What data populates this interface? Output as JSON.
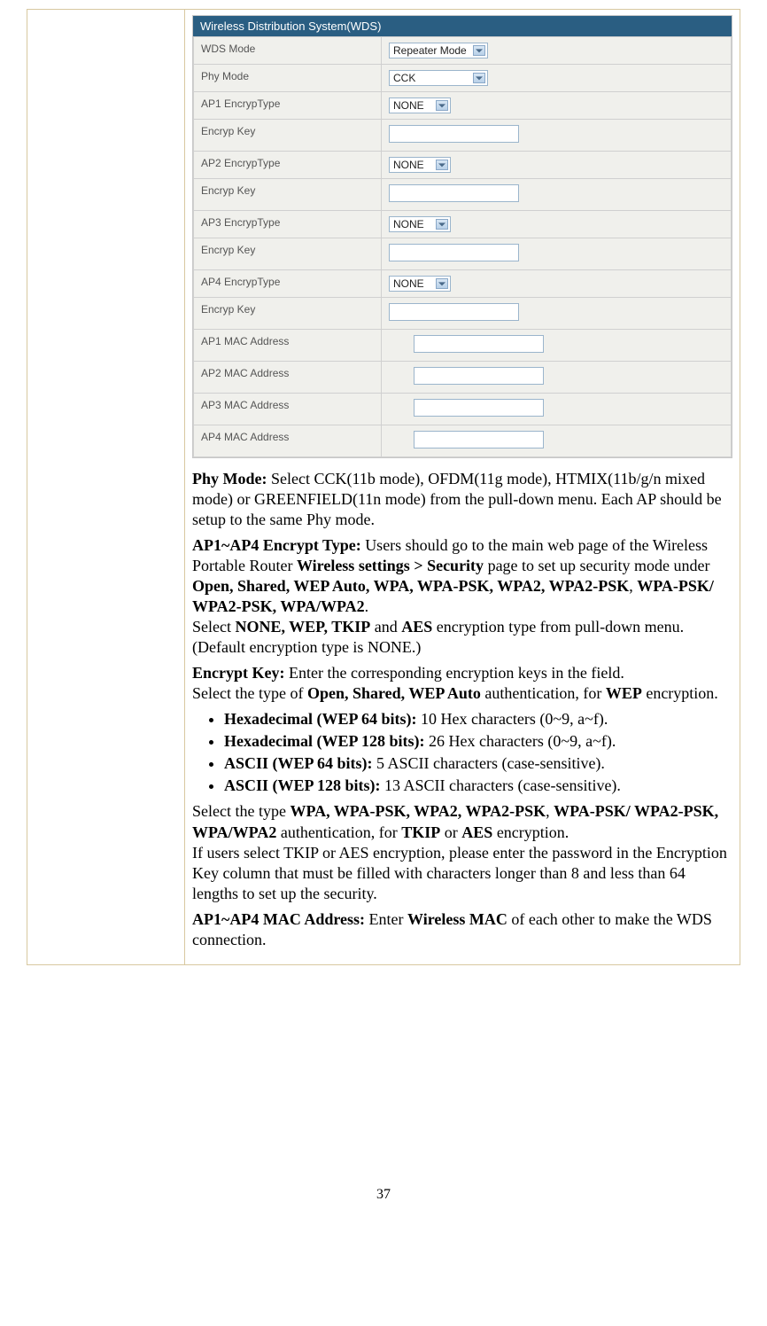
{
  "wds": {
    "title": "Wireless Distribution System(WDS)",
    "rows": [
      {
        "label": "WDS Mode",
        "type": "select",
        "value": "Repeater Mode",
        "wide": true
      },
      {
        "label": "Phy Mode",
        "type": "select",
        "value": "CCK",
        "wide": true
      },
      {
        "label": "AP1 EncrypType",
        "type": "select",
        "value": "NONE",
        "wide": false
      },
      {
        "label": "Encryp Key",
        "type": "text",
        "value": ""
      },
      {
        "label": "AP2 EncrypType",
        "type": "select",
        "value": "NONE",
        "wide": false
      },
      {
        "label": "Encryp Key",
        "type": "text",
        "value": ""
      },
      {
        "label": "AP3 EncrypType",
        "type": "select",
        "value": "NONE",
        "wide": false
      },
      {
        "label": "Encryp Key",
        "type": "text",
        "value": ""
      },
      {
        "label": "AP4 EncrypType",
        "type": "select",
        "value": "NONE",
        "wide": false
      },
      {
        "label": "Encryp Key",
        "type": "text",
        "value": ""
      },
      {
        "label": "AP1 MAC Address",
        "type": "text-mac",
        "value": ""
      },
      {
        "label": "AP2 MAC Address",
        "type": "text-mac",
        "value": ""
      },
      {
        "label": "AP3 MAC Address",
        "type": "text-mac",
        "value": ""
      },
      {
        "label": "AP4 MAC Address",
        "type": "text-mac",
        "value": ""
      }
    ]
  },
  "desc": {
    "phy_label": "Phy Mode:",
    "phy_text": " Select CCK(11b mode), OFDM(11g mode), HTMIX(11b/g/n mixed mode) or GREENFIELD(11n mode) from the pull-down menu. Each AP should be setup to the same Phy mode.",
    "enc_label": "AP1~AP4 Encrypt Type:",
    "enc_text1": " Users should go to the main web page of the Wireless Portable Router ",
    "enc_b1": "Wireless settings > Security",
    "enc_text2": " page to set up security mode under ",
    "enc_b2": "Open, Shared, WEP Auto, WPA, WPA-PSK, WPA2, WPA2-PSK",
    "enc_comma": ", ",
    "enc_b3": "WPA-PSK/ WPA2-PSK, WPA/WPA2",
    "enc_period": ".",
    "enc_text3a": "Select ",
    "enc_b4": "NONE, WEP, TKIP",
    "enc_and": " and ",
    "enc_b5": "AES",
    "enc_text3b": "  encryption type from pull-down menu. (Default encryption type is NONE.)",
    "key_label": "Encrypt Key:",
    "key_text1": " Enter the corresponding encryption keys in the field.",
    "key_text2a": "Select the type of ",
    "key_b1": "Open, Shared, WEP Auto",
    "key_text2b": " authentication, for ",
    "key_b2": "WEP",
    "key_text2c": " encryption.",
    "bullets": [
      {
        "b": "Hexadecimal (WEP 64 bits):",
        "t": " 10 Hex characters (0~9, a~f)."
      },
      {
        "b": "Hexadecimal (WEP 128 bits):",
        "t": " 26 Hex characters (0~9, a~f)."
      },
      {
        "b": "ASCII (WEP 64 bits):",
        "t": " 5 ASCII characters (case-sensitive)."
      },
      {
        "b": "ASCII (WEP 128 bits):",
        "t": " 13 ASCII characters (case-sensitive)."
      }
    ],
    "wpa_text1": "Select the type ",
    "wpa_b1": "WPA, WPA-PSK, WPA2, WPA2-PSK",
    "wpa_c1": ", ",
    "wpa_b2": "WPA-PSK/ WPA2-PSK, WPA/WPA2",
    "wpa_text2": " authentication, for  ",
    "wpa_b3": "TKIP",
    "wpa_or": " or ",
    "wpa_b4": "AES",
    "wpa_text3": " encryption.",
    "wpa_text4": "If users select TKIP or AES encryption, please enter the password in the Encryption Key column that must be filled with characters longer than 8 and less than 64 lengths to set up the security.",
    "mac_label": "AP1~AP4 MAC Address:",
    "mac_text1": " Enter ",
    "mac_b1": "Wireless MAC",
    "mac_text2": " of each other to make the WDS connection."
  },
  "page_number": "37"
}
